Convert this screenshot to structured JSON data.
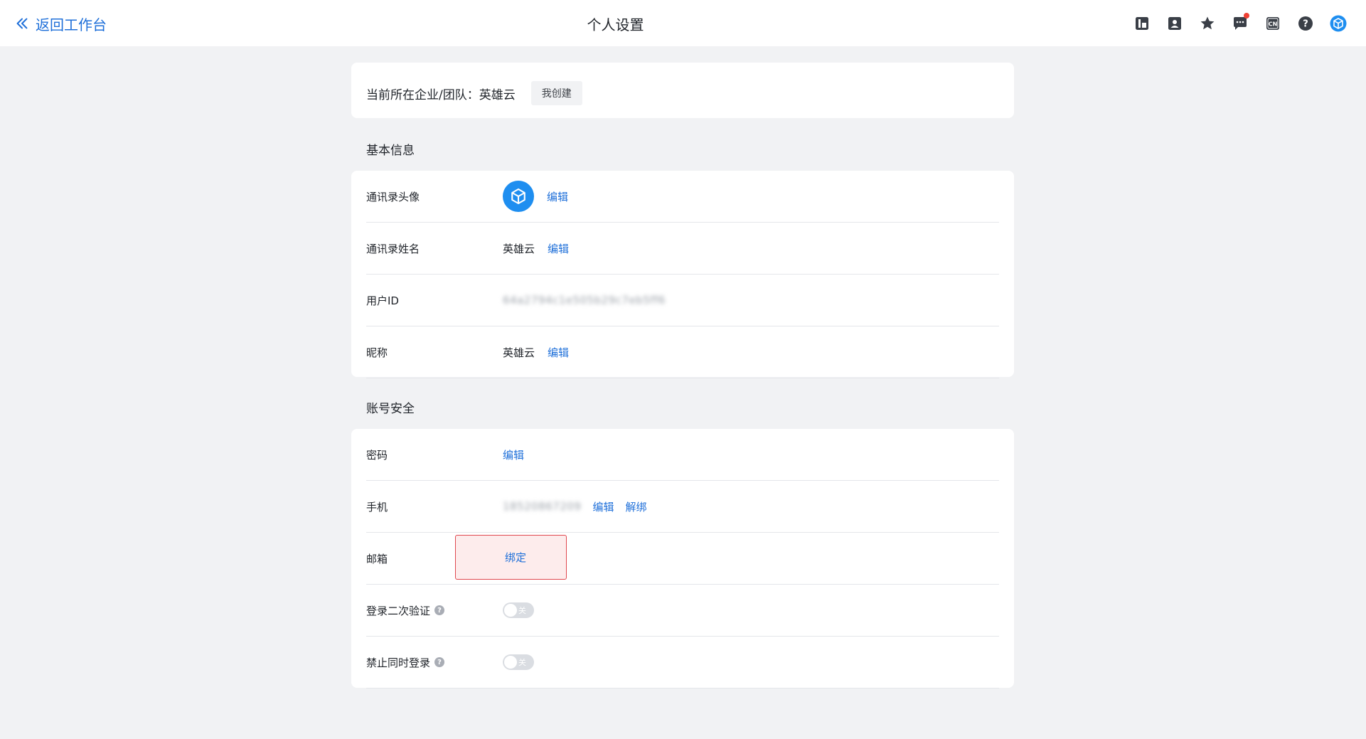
{
  "header": {
    "back_label": "返回工作台",
    "title": "个人设置",
    "icons": [
      "layout-icon",
      "contacts-icon",
      "star-icon",
      "message-icon",
      "language-cn-icon",
      "help-icon",
      "avatar-logo-icon"
    ]
  },
  "org": {
    "label": "当前所在企业/团队：英雄云",
    "tag": "我创建"
  },
  "basic": {
    "title": "基本信息",
    "rows": [
      {
        "label": "通讯录头像",
        "action": "编辑"
      },
      {
        "label": "通讯录姓名",
        "value": "英雄云",
        "action": "编辑"
      },
      {
        "label": "用户ID",
        "value": "64a2794c1e505b29c7eb5ff6"
      },
      {
        "label": "昵称",
        "value": "英雄云",
        "action": "编辑"
      }
    ]
  },
  "security": {
    "title": "账号安全",
    "rows": [
      {
        "label": "密码",
        "action": "编辑"
      },
      {
        "label": "手机",
        "value": "18520867209",
        "action": "编辑",
        "action2": "解绑"
      },
      {
        "label": "邮箱",
        "action": "绑定"
      },
      {
        "label": "登录二次验证",
        "toggle": "关"
      },
      {
        "label": "禁止同时登录",
        "toggle": "关"
      }
    ]
  },
  "colors": {
    "accent": "#1e6fd9",
    "background": "#f1f2f4",
    "highlight_border": "#e0484f",
    "highlight_fill": "#fdecec"
  }
}
